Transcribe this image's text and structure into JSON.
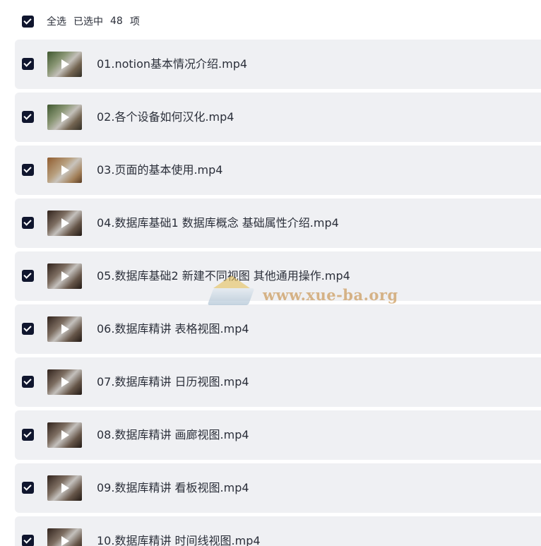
{
  "header": {
    "select_all_label": "全选",
    "selected_prefix": "已选中",
    "selected_count": "48",
    "selected_suffix": "项"
  },
  "files": [
    {
      "name": "01.notion基本情况介绍.mp4",
      "checked": true
    },
    {
      "name": "02.各个设备如何汉化.mp4",
      "checked": true
    },
    {
      "name": "03.页面的基本使用.mp4",
      "checked": true
    },
    {
      "name": "04.数据库基础1 数据库概念 基础属性介绍.mp4",
      "checked": true
    },
    {
      "name": "05.数据库基础2 新建不同视图 其他通用操作.mp4",
      "checked": true
    },
    {
      "name": "06.数据库精讲 表格视图.mp4",
      "checked": true
    },
    {
      "name": "07.数据库精讲 日历视图.mp4",
      "checked": true
    },
    {
      "name": "08.数据库精讲 画廊视图.mp4",
      "checked": true
    },
    {
      "name": "09.数据库精讲 看板视图.mp4",
      "checked": true
    },
    {
      "name": "10.数据库精讲 时间线视图.mp4",
      "checked": true
    }
  ],
  "watermark": {
    "text": "www.xue-ba.org"
  },
  "colors": {
    "checkbox": "#10162e",
    "row_background": "#eff0f3",
    "text": "#2b2f3a",
    "watermark_text": "#c58a3e"
  }
}
